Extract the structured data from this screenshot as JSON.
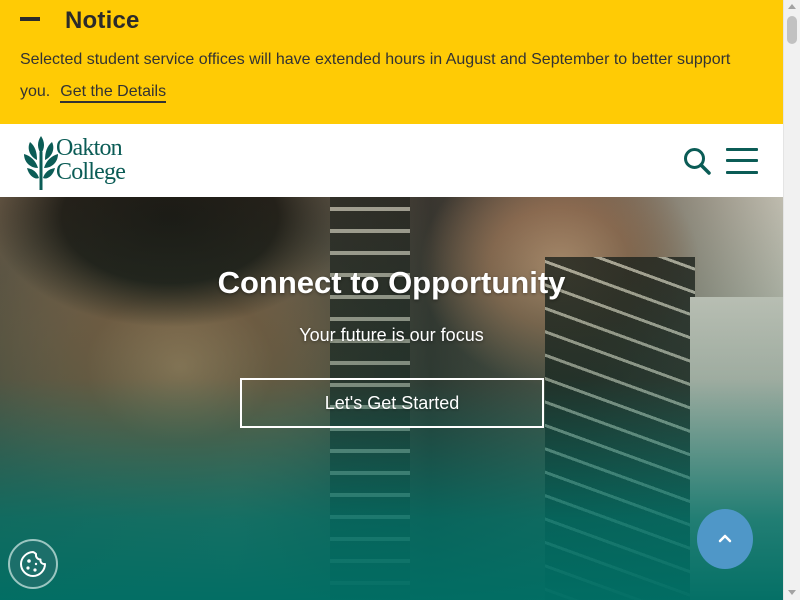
{
  "notice": {
    "title": "Notice",
    "message": "Selected student service offices will have extended hours in August and September to better support you.",
    "link_label": "Get the Details",
    "background_color": "#ffcb05"
  },
  "header": {
    "logo_line1": "Oakton",
    "logo_line2": "College",
    "brand_color": "#0b5c56",
    "search_icon": "search-icon",
    "menu_icon": "hamburger-menu-icon"
  },
  "hero": {
    "title": "Connect to Opportunity",
    "subtitle": "Your future is our focus",
    "cta_label": "Let's Get Started",
    "overlay_color": "#006e64"
  },
  "floating": {
    "back_to_top_icon": "chevron-up-icon",
    "back_to_top_color": "#4f97c8",
    "cookie_icon": "cookie-icon"
  }
}
